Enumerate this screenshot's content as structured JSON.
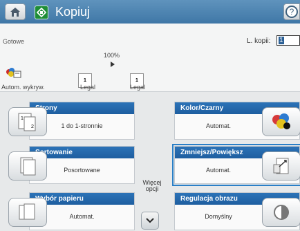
{
  "header": {
    "title": "Kopiuj",
    "help": "?"
  },
  "status": {
    "text": "Gotowe",
    "copies_label": "L. kopii:",
    "copies_value": "1"
  },
  "preview": {
    "zoom": "100%",
    "left_page_number": "1",
    "right_page_number": "1",
    "left_paper": "Legal",
    "right_paper": "Legal",
    "autodetect_label": "Autom. wykryw."
  },
  "tiles": {
    "left": [
      {
        "title": "Strony",
        "value": "1 do 1-stronnie"
      },
      {
        "title": "Sortowanie",
        "value": "Posortowane"
      },
      {
        "title": "Wybór papieru",
        "value": "Automat."
      }
    ],
    "right": [
      {
        "title": "Kolor/Czarny",
        "value": "Automat."
      },
      {
        "title": "Zmniejsz/Powiększ",
        "value": "Automat."
      },
      {
        "title": "Regulacja obrazu",
        "value": "Domyślny"
      }
    ]
  },
  "more_options": "Więcej opcji",
  "icons": {
    "home": "home-icon",
    "copy": "copy-icon",
    "help": "help-icon",
    "duplex": "duplex-icon",
    "collate": "collate-icon",
    "paper": "paper-selection-icon",
    "color": "color-icon",
    "resize": "resize-icon",
    "image": "image-adjust-icon",
    "more": "chevron-down-icon"
  },
  "colors": {
    "title_bar": "#4a7fb0",
    "tile_header": "#2266ad",
    "selection": "#2a7fc7",
    "copy_badge": "#1e8d37"
  }
}
